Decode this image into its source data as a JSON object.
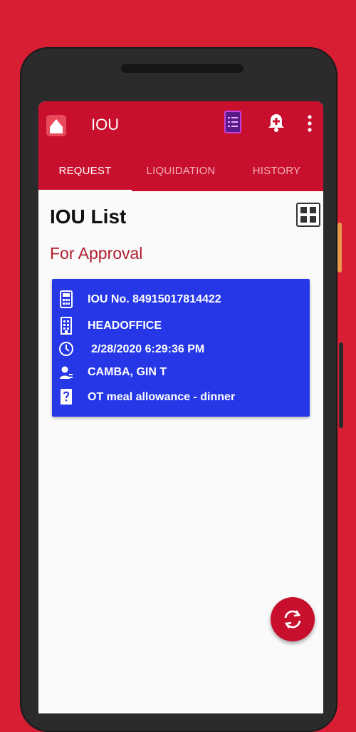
{
  "app": {
    "title": "IOU"
  },
  "tabs": [
    {
      "label": "REQUEST",
      "active": true
    },
    {
      "label": "LIQUIDATION",
      "active": false
    },
    {
      "label": "HISTORY",
      "active": false
    }
  ],
  "page": {
    "title": "IOU List",
    "section": "For Approval"
  },
  "card": {
    "iou_number": "IOU No. 84915017814422",
    "office": "HEADOFFICE",
    "datetime": "2/28/2020 6:29:36 PM",
    "employee": "CAMBA, GIN T",
    "purpose": "OT meal allowance - dinner"
  },
  "icons": {
    "logo": "app-logo-icon",
    "list": "list-document-icon",
    "notifications": "bell-add-icon",
    "more": "more-vert-icon",
    "grid": "grid-view-icon",
    "calculator": "calculator-icon",
    "building": "building-icon",
    "clock": "clock-icon",
    "person": "person-icon",
    "question": "question-icon",
    "refresh": "refresh-icon"
  },
  "colors": {
    "background": "#d81e32",
    "appbar": "#c8102e",
    "card": "#2637e8",
    "section_title": "#b01e2e"
  }
}
